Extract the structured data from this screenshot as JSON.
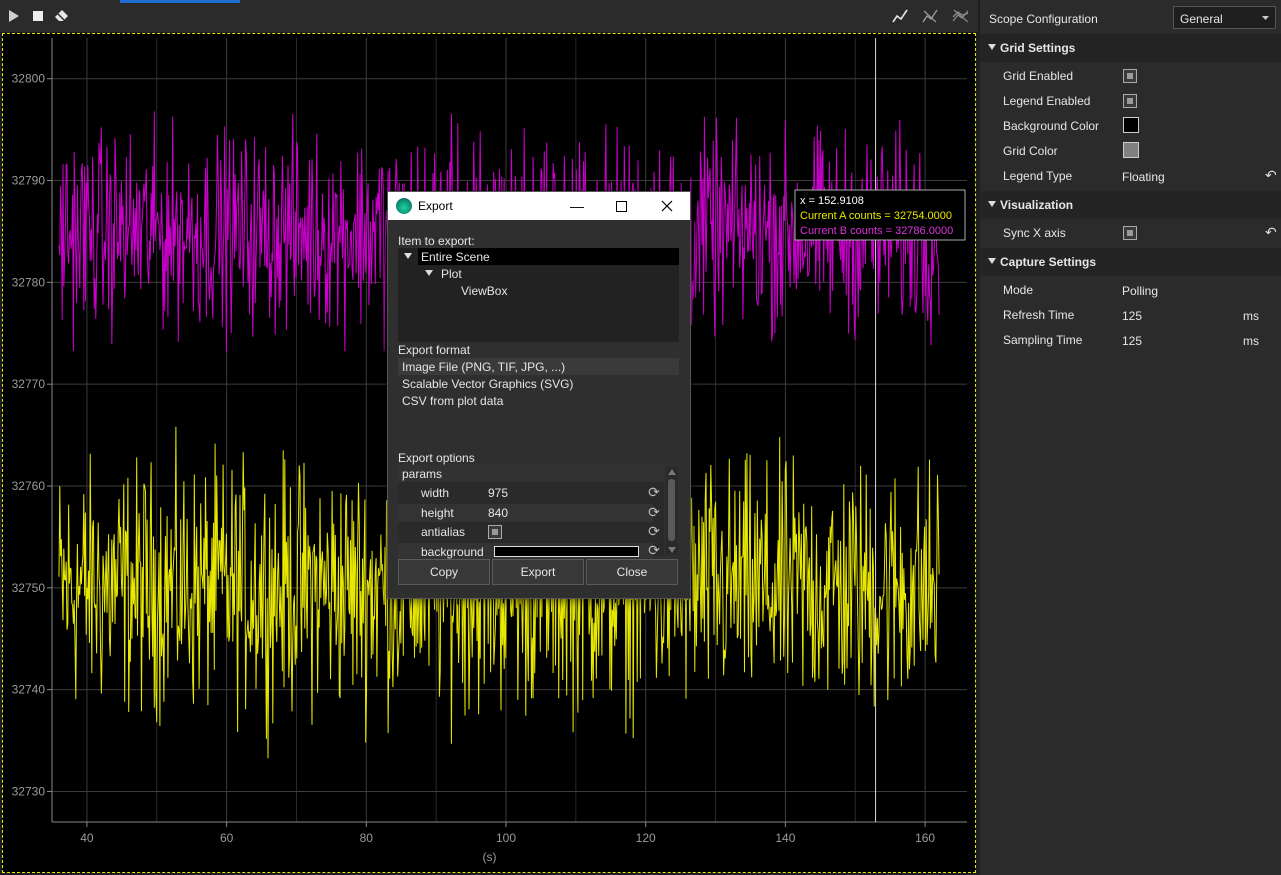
{
  "toolbar": {
    "buttons": [
      "play-icon",
      "stop-icon",
      "eraser-icon"
    ],
    "right_icons": [
      "trend-line-icon",
      "trend-line-off-icon",
      "trend-multi-icon"
    ]
  },
  "chart_data": {
    "type": "line",
    "x_range": [
      36,
      162
    ],
    "xlim": [
      35,
      166
    ],
    "ylim": [
      32727,
      32804
    ],
    "xticks": [
      40,
      60,
      80,
      100,
      120,
      140,
      160
    ],
    "yticks": [
      32730,
      32740,
      32750,
      32760,
      32770,
      32780,
      32790,
      32800
    ],
    "xlabel": "(s)",
    "ylabel": "",
    "grid": true,
    "cursor_x": 152.9108,
    "series": [
      {
        "name": "Current A counts",
        "color": "#e8e800",
        "center": 32750,
        "spread": 9.5
      },
      {
        "name": "Current B counts",
        "color": "#cc00cc",
        "center": 32785,
        "spread": 7.5
      }
    ],
    "legend": {
      "x_text": "x = 152.9108",
      "a_text": "Current A counts = 32754.0000",
      "b_text": "Current B counts = 32786.0000",
      "placement": "top-right"
    }
  },
  "dialog": {
    "title": "Export",
    "item_label": "Item to export:",
    "tree": [
      "Entire Scene",
      "Plot",
      "ViewBox"
    ],
    "format_label": "Export format",
    "formats": [
      "Image File (PNG, TIF, JPG, ...)",
      "Scalable Vector Graphics (SVG)",
      "CSV from plot data"
    ],
    "options_label": "Export options",
    "params_header": "params",
    "params": {
      "width_name": "width",
      "width_value": "975",
      "height_name": "height",
      "height_value": "840",
      "antialias_name": "antialias",
      "background_name": "background"
    },
    "buttons": {
      "copy": "Copy",
      "export": "Export",
      "close": "Close"
    }
  },
  "panel": {
    "title": "Scope Configuration",
    "mode_select": "General",
    "sections": {
      "grid": "Grid Settings",
      "visualization": "Visualization",
      "capture": "Capture Settings"
    },
    "grid_enabled": "Grid Enabled",
    "legend_enabled": "Legend Enabled",
    "background_color_label": "Background Color",
    "background_color": "#000000",
    "grid_color_label": "Grid Color",
    "grid_color": "#808080",
    "legend_type_label": "Legend Type",
    "legend_type": "Floating",
    "sync_x": "Sync X axis",
    "mode_label": "Mode",
    "mode_value": "Polling",
    "refresh_label": "Refresh Time",
    "refresh_value": "125",
    "sampling_label": "Sampling Time",
    "sampling_value": "125",
    "unit": "ms"
  }
}
